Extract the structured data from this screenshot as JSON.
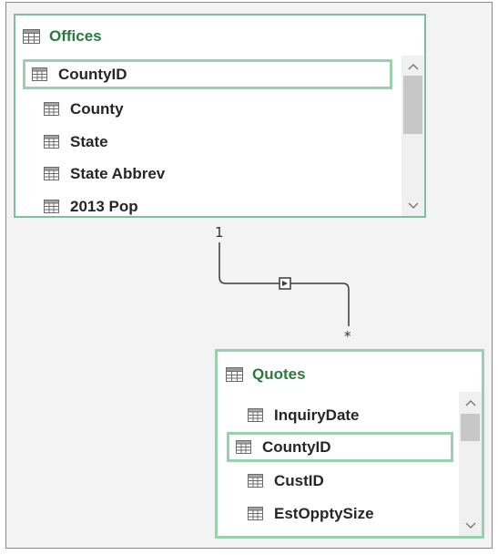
{
  "relationship": {
    "one_label": "1",
    "many_label": "*"
  },
  "offices": {
    "title": "Offices",
    "fields": [
      "CountyID",
      "County",
      "State",
      "State Abbrev",
      "2013 Pop"
    ],
    "selected_field": "CountyID"
  },
  "quotes": {
    "title": "Quotes",
    "fields": [
      "InquiryDate",
      "CountyID",
      "CustID",
      "EstOpptySize"
    ],
    "selected_field": "CountyID"
  },
  "icons": {
    "table": "table-icon",
    "field": "field-icon",
    "scroll_up": "chevron-up-icon",
    "scroll_down": "chevron-down-icon",
    "direction": "filter-direction-arrow-icon"
  },
  "colors": {
    "title_green": "#2a7a3e",
    "selection_border": "#99d1b0",
    "canvas_bg": "#f3f3f3"
  }
}
